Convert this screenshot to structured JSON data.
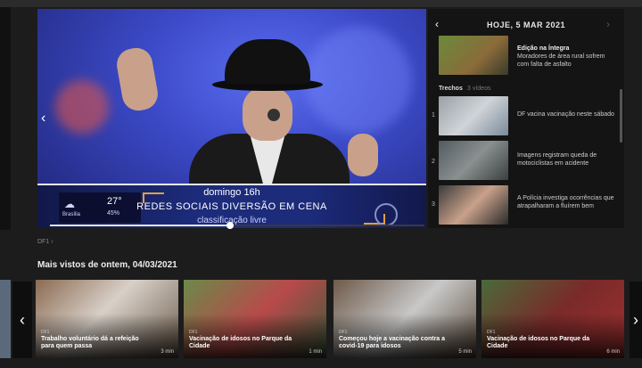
{
  "player": {
    "lower_third": {
      "day_time": "domingo 16h",
      "program_title": "REDES SOCIAIS DIVERSÃO EM CENA",
      "rating": "classificação livre"
    },
    "weather": {
      "temperature": "27°",
      "humidity": "45%",
      "city": "Brasília"
    },
    "progress_fraction": 0.48
  },
  "sidebar": {
    "date": "HOJE, 5 MAR 2021",
    "featured": {
      "title": "Edição na Íntegra",
      "subtitle": "Moradores de área rural sofrem com falta de asfalto"
    },
    "section_label": "Trechos",
    "section_count": "3 vídeos",
    "items": [
      {
        "number": "1",
        "text": "DF vacina vacinação neste sábado",
        "duration": ""
      },
      {
        "number": "2",
        "text": "Imagens registram queda de motociclistas em acidente",
        "duration": ""
      },
      {
        "number": "3",
        "text": "A Polícia investiga ocorrências que atrapalharam a fluírem bem",
        "duration": ""
      }
    ]
  },
  "breadcrumb": "DF1",
  "carousel": {
    "title": "Mais vistos de ontem, 04/03/2021",
    "cards": [
      {
        "label": "DF1",
        "title": "Trabalho voluntário dá a refeição para quem passa",
        "duration": "3 min",
        "color": "#8b6b52"
      },
      {
        "label": "DF1",
        "title": "Vacinação de idosos no Parque da Cidade",
        "duration": "1 min",
        "color": "#b84a4a"
      },
      {
        "label": "DF1",
        "title": "Começou hoje a vacinação contra a covid-19 para idosos",
        "duration": "5 min",
        "color": "#6e5a4a"
      },
      {
        "label": "DF1",
        "title": "Vacinação de idosos no Parque da Cidade",
        "duration": "6 min",
        "color": "#7a2a2a"
      }
    ]
  },
  "colors": {
    "background": "#1c1c1c",
    "sidebar": "#141414",
    "lower_third": "#1c2b7a",
    "accent_bracket": "#e0a040"
  }
}
